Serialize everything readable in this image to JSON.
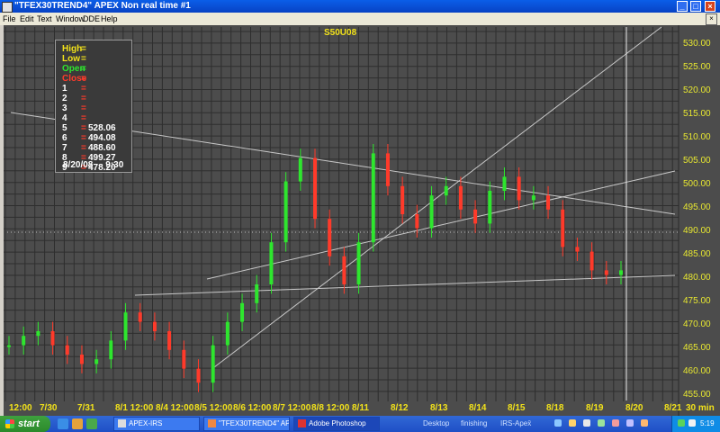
{
  "window": {
    "title": "\"TFEX30TREND4\" APEX Non real time #1",
    "buttons": {
      "minimize": "_",
      "maximize": "□",
      "close": "×"
    }
  },
  "menu": {
    "items": [
      "File",
      "Edit",
      "Text",
      "Window",
      "DDE",
      "Help"
    ],
    "mdi_close": "×"
  },
  "chart": {
    "symbol": "S50U08",
    "legend": {
      "rows": [
        {
          "key": "High",
          "eq": "=",
          "value": "",
          "color": "#f2e21a"
        },
        {
          "key": "Low",
          "eq": "=",
          "value": "",
          "color": "#f2e21a"
        },
        {
          "key": "Open",
          "eq": "=",
          "value": "",
          "color": "#2ee62e"
        },
        {
          "key": "Close",
          "eq": "=",
          "value": "",
          "color": "#ff3a2a"
        },
        {
          "key": "1",
          "eq": "=",
          "value": "",
          "color": "#ffffff"
        },
        {
          "key": "2",
          "eq": "=",
          "value": "",
          "color": "#ffffff"
        },
        {
          "key": "3",
          "eq": "=",
          "value": "",
          "color": "#ffffff"
        },
        {
          "key": "4",
          "eq": "=",
          "value": "",
          "color": "#ffffff"
        },
        {
          "key": "5",
          "eq": "=",
          "value": "528.06",
          "color": "#ffffff"
        },
        {
          "key": "6",
          "eq": "=",
          "value": "494.08",
          "color": "#ffffff"
        },
        {
          "key": "7",
          "eq": "=",
          "value": "488.60",
          "color": "#ffffff"
        },
        {
          "key": "8",
          "eq": "=",
          "value": "499.27",
          "color": "#ffffff"
        },
        {
          "key": "9",
          "eq": "=",
          "value": "478.20",
          "color": "#ffffff"
        }
      ],
      "datetime": "8/20/08     9:30"
    },
    "y_ticks": [
      "530.00",
      "525.00",
      "520.00",
      "515.00",
      "510.00",
      "505.00",
      "500.00",
      "495.00",
      "490.00",
      "485.00",
      "480.00",
      "475.00",
      "470.00",
      "465.00",
      "460.00",
      "455.00"
    ],
    "x_ticks": [
      "12:00",
      "7/30",
      "7/31",
      "8/1 12:00",
      "8/4 12:00",
      "8/5 12:00",
      "8/6 12:00",
      "8/7 12:00",
      "8/8 12:00",
      "8/11",
      "8/12",
      "8/13",
      "8/14",
      "8/15",
      "8/18",
      "8/19",
      "8/20",
      "8/21"
    ],
    "interval": "30 min",
    "colors": {
      "up": "#2ee62e",
      "down": "#ff3a2a",
      "grid": "#2e2e2e",
      "axis_text": "#e8e830"
    }
  },
  "chart_data": {
    "type": "candlestick",
    "title": "S50U08",
    "ylim": [
      453,
      533
    ],
    "x": [
      "12:00",
      "7/30",
      "7/31",
      "8/1 12:00",
      "8/4 12:00",
      "8/5 12:00",
      "8/6 12:00",
      "8/7 12:00",
      "8/8 12:00",
      "8/11",
      "8/12",
      "8/13",
      "8/14",
      "8/15",
      "8/18",
      "8/19",
      "8/20",
      "8/21"
    ],
    "series": [
      {
        "values": [
          465,
          467,
          468,
          465,
          463,
          461,
          462,
          466,
          472,
          470,
          468,
          464,
          460,
          457,
          465,
          470,
          474,
          478,
          487,
          500,
          505,
          492,
          484,
          478,
          487,
          506,
          499,
          493,
          490,
          497,
          499,
          494,
          491,
          498,
          501,
          496,
          497,
          494,
          486,
          485,
          481,
          480,
          481
        ]
      }
    ]
  },
  "taskbar": {
    "start": "start",
    "tasks": [
      {
        "label": "APEX-IRS",
        "active": false
      },
      {
        "label": "\"TFEX30TREND4\" AP...",
        "active": false
      },
      {
        "label": "Adobe Photoshop",
        "active": true
      }
    ],
    "tray_items": [
      "Desktop",
      "finishing",
      "IRS-Apex̆"
    ],
    "clock": "5:19"
  }
}
